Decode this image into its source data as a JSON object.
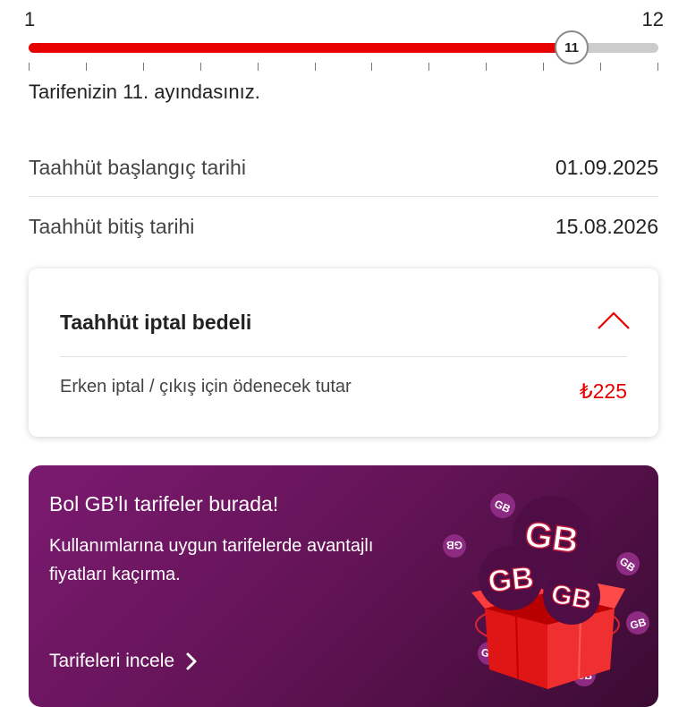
{
  "slider": {
    "min_label": "1",
    "max_label": "12",
    "current": "11",
    "min": 1,
    "max": 12,
    "value": 11,
    "tick_count": 12
  },
  "progress_text": "Tarifenizin 11. ayındasınız.",
  "commitment": {
    "start_label": "Taahhüt başlangıç tarihi",
    "start_value": "01.09.2025",
    "end_label": "Taahhüt bitiş tarihi",
    "end_value": "15.08.2026"
  },
  "cancellation_card": {
    "title": "Taahhüt iptal bedeli",
    "fee_label": "Erken iptal / çıkış için ödenecek tutar",
    "fee_value": "₺225",
    "expanded": true
  },
  "promo": {
    "title": "Bol GB'lı tarifeler burada!",
    "text": "Kullanımlarına uygun tarifelerde avantajlı fiyatları kaçırma.",
    "link_label": "Tarifeleri incele",
    "badge_text": "GB"
  },
  "colors": {
    "accent": "#e60000",
    "track": "#cccccc",
    "promo_bg": "#651458"
  },
  "icons": {
    "collapse": "chevron-up-icon",
    "link_arrow": "chevron-right-icon",
    "illustration": "gift-box-gb-illustration"
  }
}
